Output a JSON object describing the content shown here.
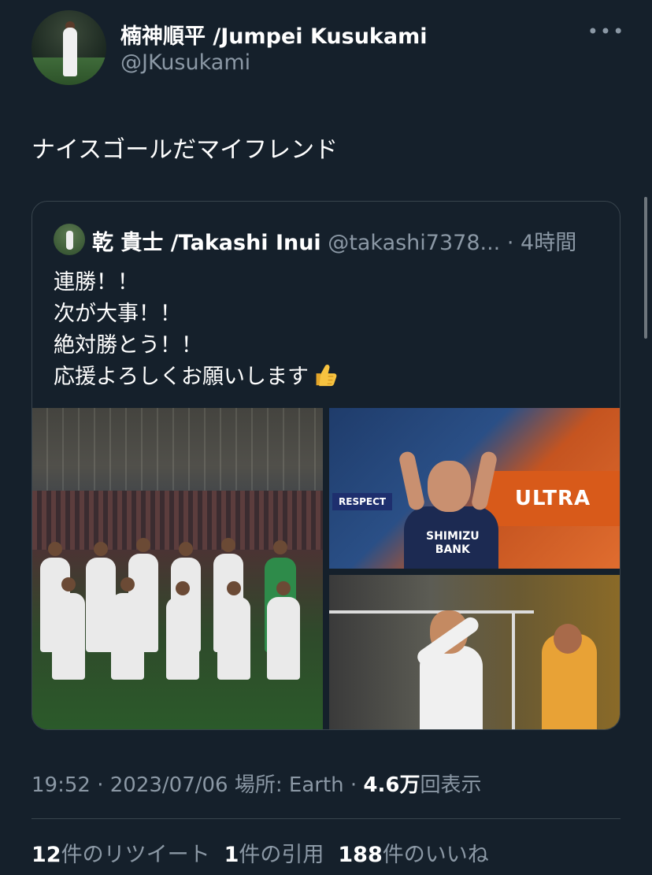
{
  "author": {
    "name": "楠神順平 /Jumpei Kusukami",
    "handle": "@JKusukami"
  },
  "more_label": "•••",
  "tweet": {
    "text": "ナイスゴールだマイフレンド"
  },
  "quoted": {
    "name": "乾 貴士 /Takashi Inui",
    "handle": "@takashi7378...",
    "separator": " · ",
    "time": "4時間",
    "lines": [
      "連勝！！",
      "次が大事！！",
      "絶対勝とう！！",
      "応援よろしくお願いします"
    ],
    "emoji": "thumbs-up-icon",
    "media": {
      "banner_text": "ULTRA",
      "respect_text": "RESPECT",
      "jersey_text_1": "SHIMIZU",
      "jersey_text_2": "BANK"
    }
  },
  "meta": {
    "time": "19:52",
    "sep1": " · ",
    "date": "2023/07/06",
    "location_label": " 場所: ",
    "location": "Earth",
    "sep2": " · ",
    "views": "4.6万",
    "views_label": "回表示"
  },
  "stats": {
    "retweets_num": "12",
    "retweets_label": "件のリツイート",
    "quotes_num": "1",
    "quotes_label": "件の引用",
    "likes_num": "188",
    "likes_label": "件のいいね"
  },
  "colors": {
    "background": "#15202b",
    "secondary_text": "#8b98a5",
    "border": "#38444d"
  }
}
